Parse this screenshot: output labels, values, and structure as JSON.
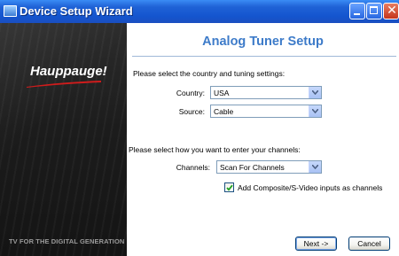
{
  "window": {
    "title": "Device Setup Wizard",
    "icon": "app-window-icon",
    "controls": {
      "minimize": "minimize-icon",
      "maximize": "maximize-icon",
      "close": "close-icon"
    }
  },
  "sidebar": {
    "brand": "Hauppauge!",
    "tagline": "TV FOR THE DIGITAL GENERATION"
  },
  "main": {
    "title": "Analog Tuner Setup",
    "country_prompt": "Please select the country and tuning settings:",
    "country_label": "Country:",
    "country_value": "USA",
    "source_label": "Source:",
    "source_value": "Cable",
    "channels_prompt": "Please select how you want to enter your channels:",
    "channels_label": "Channels:",
    "channels_value": "Scan For Channels",
    "composite_checkbox_label": "Add Composite/S-Video inputs as channels",
    "composite_checked": true
  },
  "buttons": {
    "next": "Next ->",
    "cancel": "Cancel"
  },
  "colors": {
    "title_accent": "#3d7bc9",
    "titlebar_blue": "#1455cf",
    "brand_swoosh": "#d01c1c"
  }
}
